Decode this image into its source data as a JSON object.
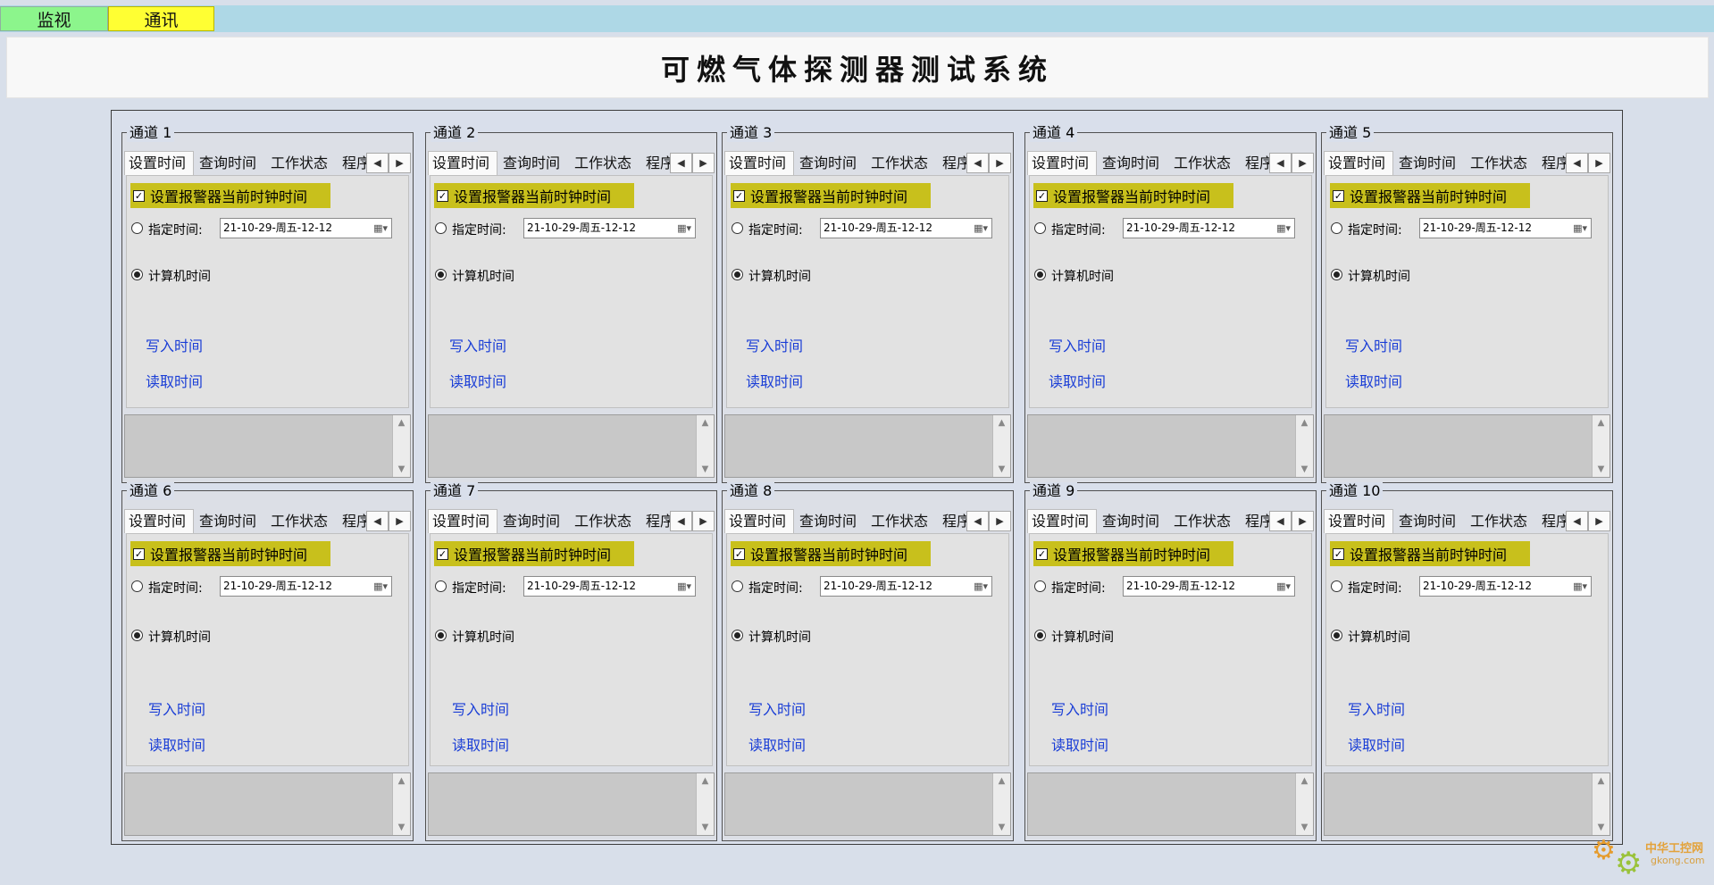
{
  "nav": {
    "tabs": [
      "监视",
      "通讯"
    ]
  },
  "header": {
    "title": "可燃气体探测器测试系统"
  },
  "tabs": [
    "设置时间",
    "查询时间",
    "工作状态",
    "程序"
  ],
  "settings": {
    "checkbox_label": "设置报警器当前时钟时间",
    "radio_specified": "指定时间:",
    "radio_computer": "计算机时间",
    "date_value": "21-10-29-周五-12-12",
    "write_button": "写入时间",
    "read_button": "读取时间"
  },
  "channels": [
    {
      "name": "通道 1"
    },
    {
      "name": "通道  2"
    },
    {
      "name": "通道 3"
    },
    {
      "name": "通道 4"
    },
    {
      "name": "通道 5"
    },
    {
      "name": "通道 6"
    },
    {
      "name": "通道  7"
    },
    {
      "name": "通道  8"
    },
    {
      "name": "通道  9"
    },
    {
      "name": "通道  10"
    }
  ],
  "icons": {
    "checkbox": "checkmark-icon",
    "date": "calendar-icon",
    "scroll_left": "chevron-left-icon",
    "scroll_right": "chevron-right-icon"
  },
  "watermark": {
    "name": "中华工控网",
    "url": "gkong.com"
  },
  "colors": {
    "monitor_tab": "#8cf58c",
    "comm_tab": "#ffff33",
    "highlight": "#c8c01c",
    "link": "#1a3ed6"
  }
}
